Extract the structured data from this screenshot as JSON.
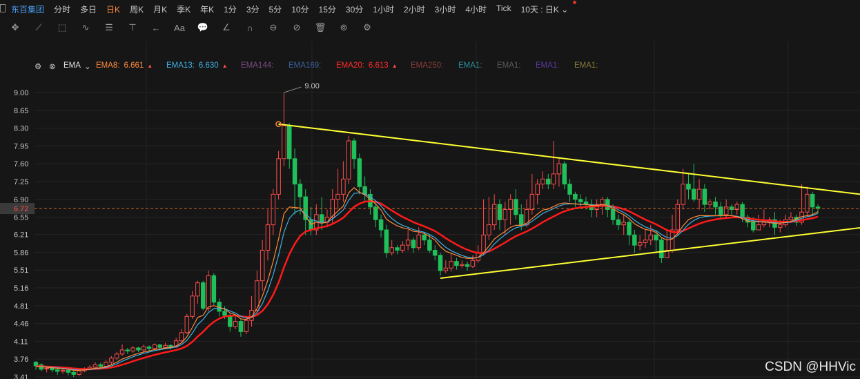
{
  "topbar": {
    "stock_name": "东百集团",
    "timeframes": [
      "分时",
      "多日",
      "日K",
      "周K",
      "月K",
      "季K",
      "年K",
      "1分",
      "3分",
      "5分",
      "10分",
      "15分",
      "30分",
      "1小时",
      "2小时",
      "3小时",
      "4小时",
      "Tick"
    ],
    "active_timeframe": "日K",
    "combo_label": "10天 : 日K"
  },
  "toolbar": {
    "icons": [
      "move-icon",
      "line-tool-icon",
      "rect-tool-icon",
      "wave-tool-icon",
      "text-align-icon",
      "fib-tool-icon",
      "arrow-tool-icon",
      "text-tool-icon",
      "comment-icon",
      "ruler-icon",
      "magnet-icon",
      "lock-icon",
      "hide-icon",
      "delete-icon",
      "link-icon",
      "settings-icon"
    ],
    "glyphs": [
      "✥",
      "⟋",
      "⬚",
      "∿",
      "☰",
      "⊤",
      "←",
      "Aa",
      "💬",
      "∠",
      "∩",
      "⊖",
      "⊘",
      "🗑",
      "⊚",
      "⚙"
    ]
  },
  "legend": {
    "indicator": "EMA",
    "items": [
      {
        "label": "EMA8:",
        "value": "6.661",
        "trend": "▲",
        "color": "#ff8a3d"
      },
      {
        "label": "EMA13:",
        "value": "6.630",
        "trend": "▲",
        "color": "#3fb0e8"
      },
      {
        "label": "EMA144:",
        "value": "",
        "trend": "",
        "color": "#7a4a86"
      },
      {
        "label": "EMA169:",
        "value": "",
        "trend": "",
        "color": "#3a5f9a"
      },
      {
        "label": "EMA20:",
        "value": "6.613",
        "trend": "▲",
        "color": "#ff2a2a"
      },
      {
        "label": "EMA250:",
        "value": "",
        "trend": "",
        "color": "#8a3a3a"
      },
      {
        "label": "EMA1:",
        "value": "",
        "trend": "",
        "color": "#2a8a9a"
      },
      {
        "label": "EMA1:",
        "value": "",
        "trend": "",
        "color": "#5a5a5a"
      },
      {
        "label": "EMA1:",
        "value": "",
        "trend": "",
        "color": "#5a3a9a"
      },
      {
        "label": "EMA1:",
        "value": "",
        "trend": "",
        "color": "#8a7a3a"
      }
    ]
  },
  "chart_data": {
    "type": "candlestick",
    "y_ticks": [
      "9.00",
      "8.65",
      "8.30",
      "7.95",
      "7.60",
      "7.25",
      "6.90",
      "6.55",
      "6.21",
      "5.86",
      "5.51",
      "5.16",
      "4.81",
      "4.46",
      "4.11",
      "3.76",
      "3.41"
    ],
    "ylim": [
      3.41,
      9.0
    ],
    "current_price": "6.72",
    "high_annotation": "9.00",
    "colors": {
      "up": "#ff4d4d",
      "down": "#1fbf5a",
      "ema_fast": "#ff8a3d",
      "ema_mid": "#3fb0e8",
      "ema_slow": "#ff1a1a",
      "trendline": "#ffff33",
      "price_line": "#d4622a"
    },
    "candles": [
      [
        3.7,
        3.63,
        3.72,
        3.55
      ],
      [
        3.65,
        3.56,
        3.68,
        3.52
      ],
      [
        3.57,
        3.58,
        3.61,
        3.5
      ],
      [
        3.58,
        3.55,
        3.62,
        3.5
      ],
      [
        3.55,
        3.52,
        3.58,
        3.45
      ],
      [
        3.52,
        3.54,
        3.57,
        3.47
      ],
      [
        3.54,
        3.5,
        3.56,
        3.44
      ],
      [
        3.5,
        3.46,
        3.53,
        3.41
      ],
      [
        3.46,
        3.53,
        3.56,
        3.43
      ],
      [
        3.53,
        3.57,
        3.6,
        3.5
      ],
      [
        3.57,
        3.6,
        3.64,
        3.54
      ],
      [
        3.6,
        3.65,
        3.7,
        3.56
      ],
      [
        3.65,
        3.62,
        3.69,
        3.58
      ],
      [
        3.62,
        3.7,
        3.74,
        3.6
      ],
      [
        3.7,
        3.78,
        3.82,
        3.66
      ],
      [
        3.78,
        3.86,
        3.9,
        3.74
      ],
      [
        3.86,
        3.94,
        4.05,
        3.82
      ],
      [
        3.94,
        3.92,
        3.98,
        3.86
      ],
      [
        3.92,
        3.98,
        4.02,
        3.88
      ],
      [
        3.98,
        3.94,
        4.0,
        3.9
      ],
      [
        3.94,
        4.0,
        4.05,
        3.9
      ],
      [
        4.0,
        3.97,
        4.03,
        3.92
      ],
      [
        3.97,
        4.04,
        4.07,
        3.94
      ],
      [
        4.04,
        3.99,
        4.06,
        3.93
      ],
      [
        3.99,
        4.03,
        4.08,
        3.96
      ],
      [
        4.03,
        4.0,
        4.05,
        3.95
      ],
      [
        4.0,
        4.12,
        4.18,
        3.98
      ],
      [
        4.12,
        4.28,
        4.35,
        4.08
      ],
      [
        4.28,
        4.6,
        4.65,
        4.25
      ],
      [
        4.6,
        5.0,
        5.1,
        4.55
      ],
      [
        5.0,
        5.26,
        5.3,
        4.85
      ],
      [
        5.26,
        4.76,
        5.3,
        4.72
      ],
      [
        4.76,
        5.4,
        5.5,
        4.7
      ],
      [
        5.4,
        4.88,
        5.45,
        4.82
      ],
      [
        4.88,
        4.7,
        4.95,
        4.6
      ],
      [
        4.7,
        4.62,
        4.8,
        4.55
      ],
      [
        4.62,
        4.4,
        4.66,
        4.3
      ],
      [
        4.4,
        4.5,
        4.6,
        4.35
      ],
      [
        4.5,
        4.3,
        4.56,
        4.2
      ],
      [
        4.3,
        4.52,
        4.6,
        4.25
      ],
      [
        4.52,
        4.72,
        5.0,
        4.4
      ],
      [
        4.72,
        5.3,
        5.5,
        4.62
      ],
      [
        5.3,
        5.9,
        6.1,
        5.1
      ],
      [
        5.9,
        6.4,
        6.7,
        5.7
      ],
      [
        6.4,
        7.0,
        7.1,
        6.2
      ],
      [
        7.0,
        7.7,
        7.85,
        6.9
      ],
      [
        7.7,
        8.35,
        9.0,
        7.55
      ],
      [
        8.35,
        7.7,
        8.4,
        7.5
      ],
      [
        7.7,
        7.2,
        7.9,
        6.6
      ],
      [
        7.2,
        6.95,
        7.3,
        6.6
      ],
      [
        6.95,
        6.5,
        7.1,
        6.2
      ],
      [
        6.5,
        6.3,
        6.75,
        6.2
      ],
      [
        6.3,
        6.6,
        6.8,
        6.2
      ],
      [
        6.6,
        6.45,
        6.95,
        6.3
      ],
      [
        6.45,
        6.55,
        6.7,
        6.35
      ],
      [
        6.55,
        6.9,
        7.1,
        6.4
      ],
      [
        6.9,
        7.0,
        7.5,
        6.7
      ],
      [
        7.0,
        7.3,
        7.65,
        6.85
      ],
      [
        7.3,
        8.05,
        8.15,
        7.2
      ],
      [
        8.05,
        7.7,
        8.1,
        7.5
      ],
      [
        7.7,
        7.15,
        7.8,
        7.0
      ],
      [
        7.15,
        7.0,
        7.35,
        6.85
      ],
      [
        7.0,
        6.75,
        7.1,
        6.6
      ],
      [
        6.75,
        6.5,
        6.85,
        6.35
      ],
      [
        6.5,
        6.3,
        6.6,
        6.15
      ],
      [
        6.3,
        5.85,
        6.4,
        5.75
      ],
      [
        5.85,
        5.95,
        6.1,
        5.8
      ],
      [
        5.95,
        5.9,
        6.0,
        5.82
      ],
      [
        5.9,
        6.0,
        6.08,
        5.85
      ],
      [
        6.0,
        6.1,
        6.3,
        5.9
      ],
      [
        6.1,
        5.95,
        6.15,
        5.85
      ],
      [
        5.95,
        6.2,
        6.35,
        5.9
      ],
      [
        6.2,
        6.1,
        6.25,
        6.0
      ],
      [
        6.1,
        5.9,
        6.2,
        5.85
      ],
      [
        5.9,
        5.8,
        6.0,
        5.7
      ],
      [
        5.8,
        5.5,
        5.85,
        5.4
      ],
      [
        5.5,
        5.55,
        5.7,
        5.45
      ],
      [
        5.55,
        5.68,
        5.85,
        5.48
      ],
      [
        5.68,
        5.6,
        5.75,
        5.52
      ],
      [
        5.6,
        5.62,
        5.7,
        5.55
      ],
      [
        5.62,
        5.58,
        5.68,
        5.5
      ],
      [
        5.58,
        5.7,
        5.8,
        5.55
      ],
      [
        5.7,
        5.85,
        6.0,
        5.65
      ],
      [
        5.85,
        6.2,
        6.9,
        5.8
      ],
      [
        6.2,
        6.4,
        6.95,
        6.1
      ],
      [
        6.4,
        6.8,
        7.0,
        6.3
      ],
      [
        6.8,
        6.5,
        6.9,
        6.3
      ],
      [
        6.5,
        6.7,
        6.85,
        6.2
      ],
      [
        6.7,
        6.9,
        7.0,
        6.4
      ],
      [
        6.9,
        6.6,
        7.1,
        6.5
      ],
      [
        6.6,
        6.4,
        6.8,
        6.3
      ],
      [
        6.4,
        6.7,
        6.9,
        6.35
      ],
      [
        6.7,
        7.0,
        7.4,
        6.6
      ],
      [
        7.0,
        7.2,
        7.3,
        6.8
      ],
      [
        7.2,
        7.3,
        7.45,
        7.1
      ],
      [
        7.3,
        7.2,
        7.4,
        7.1
      ],
      [
        7.2,
        7.4,
        8.05,
        7.1
      ],
      [
        7.4,
        7.6,
        7.7,
        7.15
      ],
      [
        7.6,
        7.2,
        7.65,
        7.1
      ],
      [
        7.2,
        7.0,
        7.3,
        6.85
      ],
      [
        7.0,
        6.9,
        7.05,
        6.75
      ],
      [
        6.9,
        6.85,
        7.0,
        6.75
      ],
      [
        6.85,
        6.8,
        6.95,
        6.7
      ],
      [
        6.8,
        6.7,
        6.9,
        6.55
      ],
      [
        6.7,
        6.8,
        6.9,
        6.55
      ],
      [
        6.8,
        6.9,
        6.95,
        6.6
      ],
      [
        6.9,
        6.7,
        6.95,
        6.55
      ],
      [
        6.7,
        6.5,
        6.8,
        6.4
      ],
      [
        6.5,
        6.4,
        6.6,
        6.3
      ],
      [
        6.4,
        6.45,
        6.6,
        6.2
      ],
      [
        6.45,
        6.2,
        6.5,
        6.0
      ],
      [
        6.2,
        6.0,
        6.3,
        5.85
      ],
      [
        6.0,
        6.05,
        6.2,
        5.9
      ],
      [
        6.05,
        6.1,
        6.3,
        5.95
      ],
      [
        6.1,
        6.2,
        6.4,
        6.0
      ],
      [
        6.2,
        6.1,
        6.3,
        5.85
      ],
      [
        6.1,
        5.75,
        6.15,
        5.65
      ],
      [
        5.75,
        5.9,
        6.3,
        5.8
      ],
      [
        5.9,
        6.3,
        6.6,
        5.85
      ],
      [
        6.3,
        6.8,
        6.9,
        6.2
      ],
      [
        6.8,
        7.2,
        7.5,
        6.7
      ],
      [
        7.2,
        7.1,
        7.4,
        6.9
      ],
      [
        7.1,
        6.9,
        7.6,
        6.85
      ],
      [
        6.9,
        7.1,
        7.3,
        6.7
      ],
      [
        7.1,
        6.8,
        7.2,
        6.65
      ],
      [
        6.8,
        6.85,
        6.9,
        6.7
      ],
      [
        6.85,
        6.75,
        6.95,
        6.6
      ],
      [
        6.75,
        6.6,
        6.85,
        6.5
      ],
      [
        6.6,
        6.75,
        6.9,
        6.55
      ],
      [
        6.75,
        6.7,
        6.8,
        6.6
      ],
      [
        6.7,
        6.8,
        6.85,
        6.6
      ],
      [
        6.8,
        6.55,
        6.85,
        6.45
      ],
      [
        6.55,
        6.45,
        6.6,
        6.35
      ],
      [
        6.45,
        6.3,
        6.55,
        6.25
      ],
      [
        6.3,
        6.4,
        6.6,
        6.3
      ],
      [
        6.4,
        6.45,
        6.7,
        6.35
      ],
      [
        6.45,
        6.5,
        6.55,
        6.35
      ],
      [
        6.5,
        6.35,
        6.65,
        6.2
      ],
      [
        6.35,
        6.4,
        6.5,
        6.25
      ],
      [
        6.4,
        6.5,
        6.6,
        6.35
      ],
      [
        6.5,
        6.55,
        6.65,
        6.45
      ],
      [
        6.55,
        6.45,
        6.6,
        6.38
      ],
      [
        6.45,
        6.65,
        7.2,
        6.4
      ],
      [
        6.65,
        7.0,
        7.15,
        6.55
      ],
      [
        7.0,
        6.75,
        7.05,
        6.6
      ],
      [
        6.75,
        6.72,
        6.8,
        6.62
      ]
    ],
    "ema_fast": [
      3.62,
      3.61,
      3.6,
      3.59,
      3.58,
      3.57,
      3.56,
      3.54,
      3.54,
      3.55,
      3.56,
      3.58,
      3.59,
      3.61,
      3.65,
      3.7,
      3.76,
      3.8,
      3.84,
      3.87,
      3.9,
      3.92,
      3.95,
      3.96,
      3.98,
      3.99,
      4.02,
      4.08,
      4.2,
      4.38,
      4.58,
      4.62,
      4.79,
      4.81,
      4.78,
      4.74,
      4.67,
      4.63,
      4.55,
      4.54,
      4.59,
      4.75,
      5.0,
      5.31,
      5.68,
      6.12,
      6.62,
      6.75,
      6.74,
      6.73,
      6.57,
      6.41,
      6.45,
      6.43,
      6.45,
      6.57,
      6.67,
      6.77,
      7.03,
      7.13,
      7.04,
      6.99,
      6.9,
      6.81,
      6.69,
      6.51,
      6.44,
      6.38,
      6.34,
      6.32,
      6.27,
      6.26,
      6.23,
      6.17,
      6.1,
      5.97,
      5.88,
      5.84,
      5.8,
      5.76,
      5.74,
      5.74,
      5.76,
      5.85,
      5.98,
      6.12,
      6.2,
      6.27,
      6.35,
      6.39,
      6.39,
      6.43,
      6.52,
      6.61,
      6.69,
      6.71,
      6.76,
      6.81,
      6.83,
      6.82,
      6.81,
      6.8,
      6.8,
      6.78,
      6.78,
      6.8,
      6.78,
      6.72,
      6.65,
      6.6,
      6.52,
      6.42,
      6.36,
      6.31,
      6.29,
      6.25,
      6.15,
      6.1,
      6.12,
      6.23,
      6.38,
      6.5,
      6.55,
      6.58,
      6.58,
      6.58,
      6.58,
      6.58,
      6.58,
      6.58,
      6.56,
      6.52,
      6.47,
      6.46,
      6.46,
      6.46,
      6.44,
      6.43,
      6.43,
      6.45,
      6.46,
      6.52,
      6.56,
      6.58,
      6.6,
      6.66
    ]
  }
}
